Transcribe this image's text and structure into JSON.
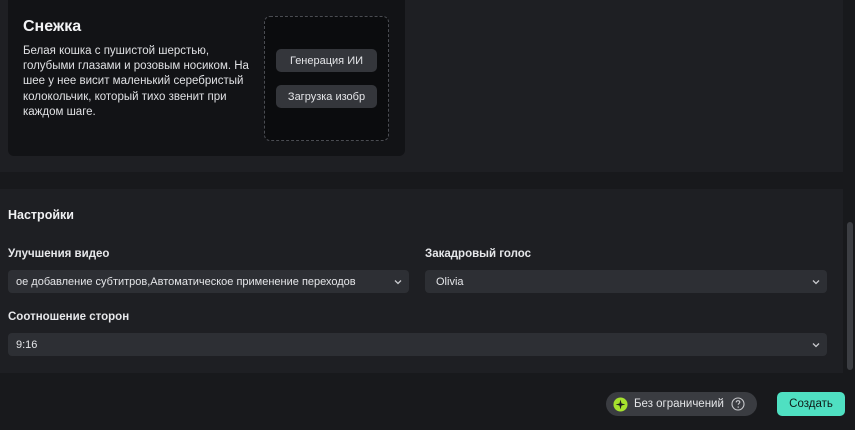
{
  "character": {
    "name": "Снежка",
    "description": "Белая кошка с пушистой шерстью, голубыми глазами и розовым носиком. На шее у нее висит маленький серебристый колокольчик, который тихо звенит при каждом шаге.",
    "generate_button": "Генерация ИИ",
    "upload_button": "Загрузка изобр"
  },
  "settings": {
    "title": "Настройки",
    "video_enhancements": {
      "label": "Улучшения видео",
      "value": "ое добавление субтитров,Автоматическое применение переходов"
    },
    "voiceover": {
      "label": "Закадровый голос",
      "value": "Olivia"
    },
    "aspect_ratio": {
      "label": "Соотношение сторон",
      "value": "9:16"
    }
  },
  "footer": {
    "limit_label": "Без ограничений",
    "create_button": "Создать"
  },
  "colors": {
    "accent": "#4fe0c2",
    "star": "#a6e22e"
  }
}
